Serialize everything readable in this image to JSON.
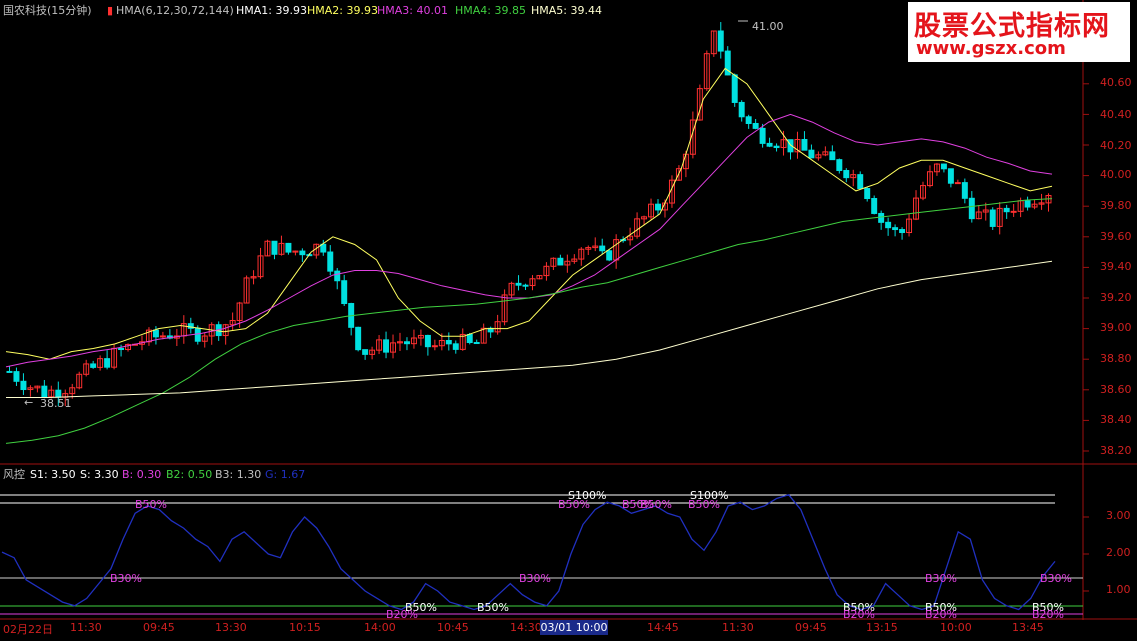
{
  "main_legend": {
    "stock": "国农科技(15分钟)",
    "indicator": "HMA(6,12,30,72,144)",
    "hma1": "HMA1: 39.93",
    "hma2": "HMA2: 39.93",
    "hma3": "HMA3: 40.01",
    "hma4": "HMA4: 39.85",
    "hma5": "HMA5: 39.44"
  },
  "sub_legend": {
    "name": "风控",
    "s1": "S1: 3.50",
    "s": "S: 3.30",
    "b": "B: 0.30",
    "b2": "B2: 0.50",
    "b3": "B3: 1.30",
    "g": "G: 1.67"
  },
  "price_axis": [
    "40.60",
    "40.40",
    "40.20",
    "40.00",
    "39.80",
    "39.60",
    "39.40",
    "39.20",
    "39.00",
    "38.80",
    "38.60",
    "38.40",
    "38.20"
  ],
  "sub_axis": [
    "3.00",
    "2.00",
    "1.00"
  ],
  "time_axis": [
    "02月22日",
    "11:30",
    "09:45",
    "13:30",
    "10:15",
    "14:00",
    "10:45",
    "14:30",
    "03/01 10:00",
    "14:45",
    "11:30",
    "09:45",
    "13:15",
    "10:00",
    "13:45"
  ],
  "annotations": {
    "high": "41.00",
    "low": "38.51"
  },
  "sub_annotations": {
    "s100": "S100%",
    "b50": "B50%",
    "b30": "B30%",
    "b20": "B20%",
    "b50_low": "B50%"
  },
  "watermark": {
    "title": "股票公式指标网",
    "url": "www.gszx.com"
  },
  "colors": {
    "up": "#ff3030",
    "down": "#00e0e0",
    "hma1": "#ffffff",
    "hma2": "#ffff60",
    "hma3": "#e040e0",
    "hma4": "#40d040",
    "hma5": "#ffffd0",
    "risk_line": "#2030c0",
    "axis": "#d02020"
  },
  "chart_data": {
    "type": "line",
    "ylim": [
      38.1,
      41.1
    ],
    "series": [
      {
        "name": "HMA2",
        "values": [
          38.85,
          38.83,
          38.8,
          38.85,
          38.87,
          38.9,
          38.95,
          39.0,
          39.02,
          39.0,
          38.98,
          39.0,
          39.1,
          39.3,
          39.5,
          39.6,
          39.55,
          39.45,
          39.2,
          39.05,
          38.95,
          38.95,
          39.0,
          39.0,
          39.05,
          39.2,
          39.35,
          39.45,
          39.55,
          39.65,
          39.75,
          40.05,
          40.5,
          40.7,
          40.6,
          40.4,
          40.2,
          40.1,
          40.0,
          39.9,
          39.95,
          40.05,
          40.1,
          40.1,
          40.05,
          40.0,
          39.95,
          39.9,
          39.93
        ]
      },
      {
        "name": "HMA3",
        "values": [
          38.75,
          38.78,
          38.8,
          38.82,
          38.85,
          38.87,
          38.9,
          38.93,
          38.95,
          38.97,
          39.0,
          39.05,
          39.12,
          39.2,
          39.28,
          39.35,
          39.38,
          39.38,
          39.36,
          39.32,
          39.28,
          39.25,
          39.22,
          39.2,
          39.2,
          39.22,
          39.28,
          39.35,
          39.45,
          39.55,
          39.65,
          39.8,
          39.95,
          40.1,
          40.25,
          40.35,
          40.4,
          40.35,
          40.28,
          40.22,
          40.2,
          40.22,
          40.24,
          40.22,
          40.18,
          40.12,
          40.08,
          40.03,
          40.01
        ]
      },
      {
        "name": "HMA4",
        "values": [
          38.25,
          38.27,
          38.3,
          38.35,
          38.42,
          38.5,
          38.58,
          38.68,
          38.8,
          38.9,
          38.97,
          39.02,
          39.05,
          39.08,
          39.1,
          39.12,
          39.14,
          39.15,
          39.16,
          39.18,
          39.2,
          39.23,
          39.27,
          39.3,
          39.35,
          39.4,
          39.45,
          39.5,
          39.55,
          39.58,
          39.62,
          39.66,
          39.7,
          39.72,
          39.74,
          39.76,
          39.78,
          39.8,
          39.82,
          39.84,
          39.85
        ]
      },
      {
        "name": "HMA5",
        "values": [
          38.55,
          38.55,
          38.56,
          38.57,
          38.58,
          38.6,
          38.62,
          38.64,
          38.66,
          38.68,
          38.7,
          38.72,
          38.74,
          38.76,
          38.8,
          38.86,
          38.94,
          39.02,
          39.1,
          39.18,
          39.26,
          39.32,
          39.36,
          39.4,
          39.44
        ]
      }
    ],
    "candles_price_range": [
      38.51,
      41.0
    ]
  }
}
